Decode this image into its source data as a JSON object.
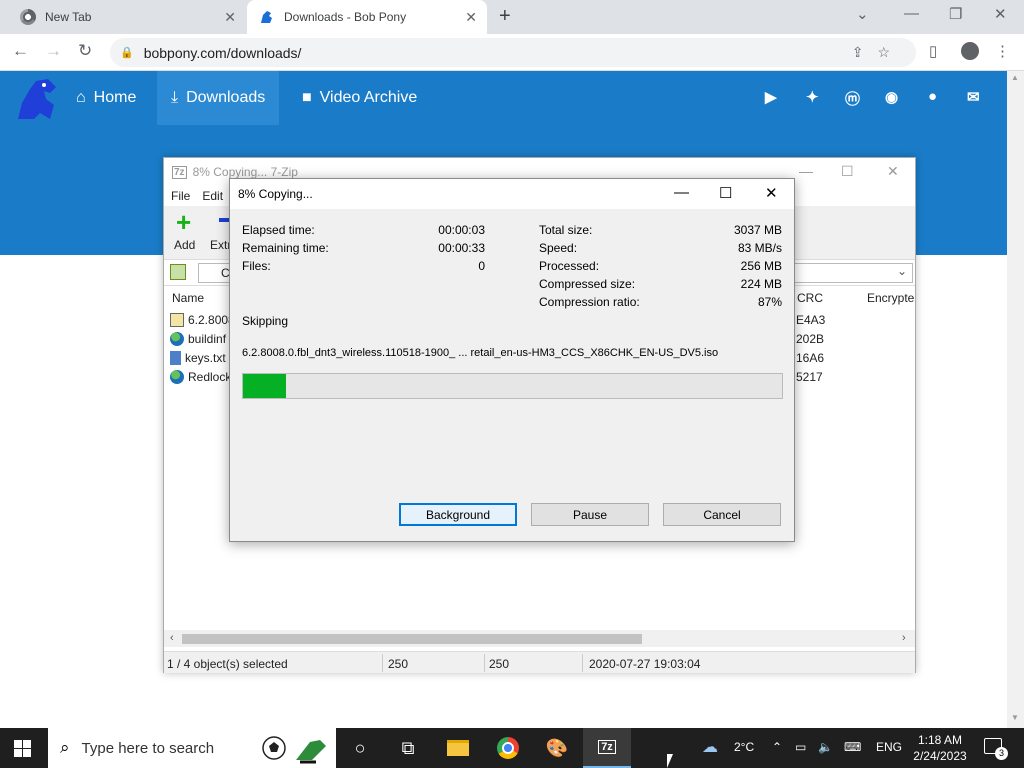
{
  "browser": {
    "tabs": [
      {
        "title": "New Tab"
      },
      {
        "title": "Downloads - Bob Pony"
      }
    ],
    "url": "bobpony.com/downloads/"
  },
  "site": {
    "nav": [
      {
        "label": "Home",
        "icon": "home-icon"
      },
      {
        "label": "Downloads",
        "icon": "download-icon"
      },
      {
        "label": "Video Archive",
        "icon": "video-icon"
      }
    ],
    "social": [
      "youtube-icon",
      "twitter-icon",
      "mastodon-icon",
      "discord-icon",
      "github-icon",
      "mail-icon"
    ],
    "accent": "#1a7cc8"
  },
  "zip": {
    "title": "8% Copying... 7-Zip",
    "menu": [
      "File",
      "Edit"
    ],
    "toolbar": {
      "add": "Add",
      "extract": "Extr"
    },
    "path_prefix": "C",
    "columns": {
      "name": "Name",
      "crc": "CRC",
      "encrypted": "Encrypte"
    },
    "files": [
      {
        "name": "6.2.8008",
        "crc": "E4A3",
        "icon": "iso-icon"
      },
      {
        "name": "buildinf",
        "crc": "202B",
        "icon": "globe-icon"
      },
      {
        "name": "keys.txt",
        "crc": "16A6",
        "icon": "text-file-icon"
      },
      {
        "name": "Redlock",
        "crc": "5217",
        "icon": "globe-icon"
      }
    ],
    "status": {
      "selected": "1 / 4 object(s) selected",
      "size": "250",
      "packed": "250",
      "modified": "2020-07-27 19:03:04"
    }
  },
  "dialog": {
    "title": "8% Copying...",
    "left_stats": [
      {
        "label": "Elapsed time:",
        "value": "00:00:03"
      },
      {
        "label": "Remaining time:",
        "value": "00:00:33"
      },
      {
        "label": "Files:",
        "value": "0"
      }
    ],
    "right_stats": [
      {
        "label": "Total size:",
        "value": "3037 MB"
      },
      {
        "label": "Speed:",
        "value": "83 MB/s"
      },
      {
        "label": "Processed:",
        "value": "256 MB"
      },
      {
        "label": "Compressed size:",
        "value": "224 MB"
      },
      {
        "label": "Compression ratio:",
        "value": "87%"
      }
    ],
    "operation": "Skipping",
    "current_file": "6.2.8008.0.fbl_dnt3_wireless.110518-1900_ ... retail_en-us-HM3_CCS_X86CHK_EN-US_DV5.iso",
    "progress_percent": 8,
    "progress_color": "#06b025",
    "buttons": {
      "background": "Background",
      "pause": "Pause",
      "cancel": "Cancel"
    }
  },
  "taskbar": {
    "search_placeholder": "Type here to search",
    "weather": "2°C",
    "language": "ENG",
    "time": "1:18 AM",
    "date": "2/24/2023",
    "notifications": "3"
  }
}
